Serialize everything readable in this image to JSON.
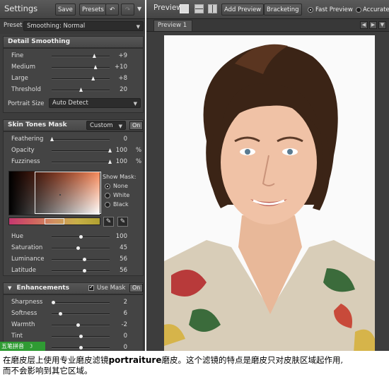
{
  "left_header": {
    "title": "Settings",
    "save": "Save",
    "presets": "Presets",
    "undo_icon": "undo-icon",
    "redo_icon": "redo-icon",
    "menu_icon": "menu-arrow-icon"
  },
  "preset": {
    "label": "Preset",
    "value": "Smoothing: Normal"
  },
  "detail": {
    "title": "Detail Smoothing",
    "sliders": [
      {
        "label": "Fine",
        "value": "+9",
        "fraction": 0.73
      },
      {
        "label": "Medium",
        "value": "+10",
        "fraction": 0.75
      },
      {
        "label": "Large",
        "value": "+8",
        "fraction": 0.71
      },
      {
        "label": "Threshold",
        "value": "20",
        "fraction": 0.5
      }
    ],
    "portrait_size_label": "Portrait Size",
    "portrait_size_value": "Auto Detect"
  },
  "skin": {
    "title": "Skin Tones Mask",
    "mode": "Custom",
    "on_label": "On",
    "sliders": [
      {
        "label": "Feathering",
        "value": "0",
        "unit": "",
        "fraction": 0.0
      },
      {
        "label": "Opacity",
        "value": "100",
        "unit": "%",
        "fraction": 1.0
      },
      {
        "label": "Fuzziness",
        "value": "100",
        "unit": "%",
        "fraction": 1.0
      }
    ],
    "show_mask_label": "Show Mask:",
    "mask_options": [
      {
        "label": "None",
        "selected": true
      },
      {
        "label": "White",
        "selected": false
      },
      {
        "label": "Black",
        "selected": false
      }
    ],
    "hsl_sliders": [
      {
        "label": "Hue",
        "value": "100",
        "fraction": 0.5
      },
      {
        "label": "Saturation",
        "value": "45",
        "fraction": 0.45
      },
      {
        "label": "Luminance",
        "value": "56",
        "fraction": 0.56
      },
      {
        "label": "Latitude",
        "value": "56",
        "fraction": 0.56
      }
    ]
  },
  "enhancements": {
    "title": "Enhancements",
    "use_mask_label": "Use Mask",
    "use_mask_checked": true,
    "on_label": "On",
    "sliders": [
      {
        "label": "Sharpness",
        "value": "2",
        "fraction": 0.02
      },
      {
        "label": "Softness",
        "value": "6",
        "fraction": 0.15
      },
      {
        "label": "Warmth",
        "value": "-2",
        "fraction": 0.45
      },
      {
        "label": "Tint",
        "value": "0",
        "fraction": 0.5
      },
      {
        "label": "",
        "value": "0",
        "fraction": 0.5
      }
    ]
  },
  "preview_bar": {
    "title": "Preview",
    "add_preview": "Add Preview",
    "bracketing": "Bracketing",
    "fast_preview": "Fast Preview",
    "accurate": "Accurate",
    "tab": "Preview 1"
  },
  "ime": {
    "label": "五笔拼音"
  },
  "caption": {
    "line1_pre": "在磨皮层上使用专业磨皮滤镜",
    "line1_bold": "portraiture",
    "line1_post": "磨皮。这个滤镜的特点是磨皮只对皮肤区域起作用,",
    "line2": "而不会影响到其它区域。"
  },
  "colors": {
    "panel": "#3d3d3d",
    "accent_green": "#2f9b33"
  }
}
